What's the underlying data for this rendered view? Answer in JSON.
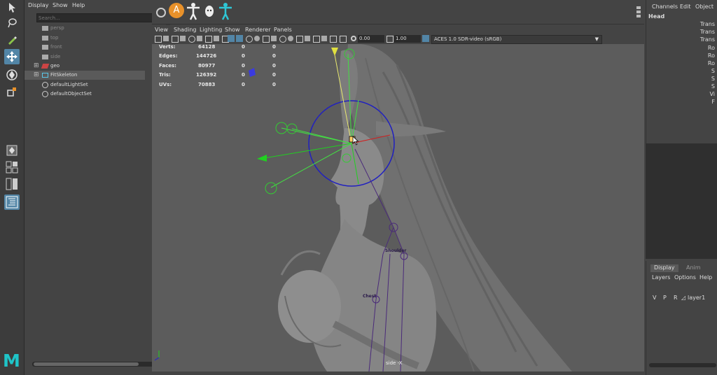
{
  "outliner": {
    "menu": [
      "Display",
      "Show",
      "Help"
    ],
    "search_placeholder": "Search...",
    "items": [
      {
        "label": "persp",
        "dim": true
      },
      {
        "label": "top",
        "dim": true
      },
      {
        "label": "front",
        "dim": true
      },
      {
        "label": "side",
        "dim": true
      },
      {
        "label": "geo",
        "dim": false
      },
      {
        "label": "FitSkeleton",
        "dim": false
      },
      {
        "label": "defaultLightSet",
        "dim": false
      },
      {
        "label": "defaultObjectSet",
        "dim": false
      }
    ]
  },
  "viewport": {
    "menu": [
      "View",
      "Shading",
      "Lighting",
      "Show",
      "Renderer",
      "Panels"
    ],
    "exposure": "0.00",
    "gamma": "1.00",
    "color_space": "ACES 1.0 SDR-video (sRGB)",
    "camera_label": "side -X",
    "hud": [
      {
        "label": "Verts:",
        "value": "64128",
        "sel": "0",
        "comp": "0"
      },
      {
        "label": "Edges:",
        "value": "144726",
        "sel": "0",
        "comp": "0"
      },
      {
        "label": "Faces:",
        "value": "80977",
        "sel": "0",
        "comp": "0"
      },
      {
        "label": "Tris:",
        "value": "126392",
        "sel": "0",
        "comp": "0"
      },
      {
        "label": "UVs:",
        "value": "70883",
        "sel": "0",
        "comp": "0"
      }
    ],
    "joint_labels": [
      "Shoulder",
      "Chest"
    ]
  },
  "channel_box": {
    "menu": [
      "Channels",
      "Edit",
      "Object"
    ],
    "object_name": "Head",
    "attributes": [
      "Trans",
      "Trans",
      "Trans",
      "Ro",
      "Ro",
      "Ro",
      "S",
      "S",
      "S",
      "Vi",
      "F"
    ]
  },
  "layers": {
    "tabs": [
      "Display",
      "Anim"
    ],
    "menu": [
      "Layers",
      "Options",
      "Help"
    ],
    "row": {
      "v": "V",
      "p": "P",
      "r": "R",
      "name": "layer1"
    }
  },
  "logo": "M",
  "colors": {
    "accent": "#5285a6",
    "shelf_orange": "#e8912a",
    "shelf_cyan": "#2ec7d6"
  }
}
